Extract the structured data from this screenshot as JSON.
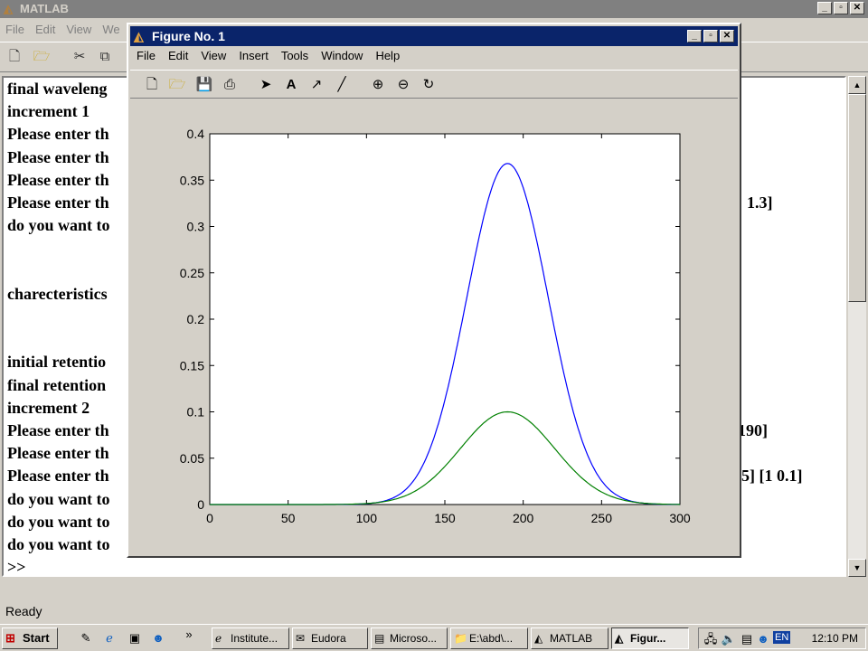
{
  "main_window": {
    "title": "MATLAB",
    "menus": [
      "File",
      "Edit",
      "View",
      "We"
    ],
    "status": "Ready"
  },
  "command_window": {
    "lines": [
      "final waveleng",
      "increment  1",
      "Please enter th",
      "Please enter th",
      "Please enter th",
      "Please enter th",
      "do you want to",
      "",
      "",
      "charecteristics",
      "",
      "",
      "initial retentio",
      "final retention",
      "increment  2",
      "Please enter th",
      "Please enter th",
      "Please enter th",
      "do you want to",
      "do you want to",
      "do you want to",
      ">>"
    ],
    "right_fragments": [
      {
        "line": 5,
        "text": "1.3]"
      },
      {
        "line": 15,
        "text": "190]"
      },
      {
        "line": 17,
        "text": "5]  [1 0.1]"
      }
    ]
  },
  "figure": {
    "title": "Figure No. 1",
    "menus": [
      "File",
      "Edit",
      "View",
      "Insert",
      "Tools",
      "Window",
      "Help"
    ]
  },
  "chart_data": {
    "type": "line",
    "title": "",
    "xlabel": "",
    "ylabel": "",
    "xlim": [
      0,
      300
    ],
    "ylim": [
      0,
      0.4
    ],
    "xticks": [
      0,
      50,
      100,
      150,
      200,
      250,
      300
    ],
    "yticks": [
      0,
      0.05,
      0.1,
      0.15,
      0.2,
      0.25,
      0.3,
      0.35,
      0.4
    ],
    "grid": false,
    "series": [
      {
        "color": "#0000ff",
        "peak_x": 190,
        "peak_y": 0.368,
        "sigma": 26,
        "x_start": 0,
        "x_end": 300
      },
      {
        "color": "#008000",
        "peak_x": 190,
        "peak_y": 0.1,
        "sigma": 30,
        "x_start": 0,
        "x_end": 300
      }
    ]
  },
  "taskbar": {
    "start": "Start",
    "tasks": [
      "Institute...",
      "Eudora",
      "Microso...",
      "E:\\abd\\...",
      "MATLAB",
      "Figur..."
    ],
    "active_task": 5,
    "tray_lang": "EN",
    "clock": "12:10 PM"
  }
}
